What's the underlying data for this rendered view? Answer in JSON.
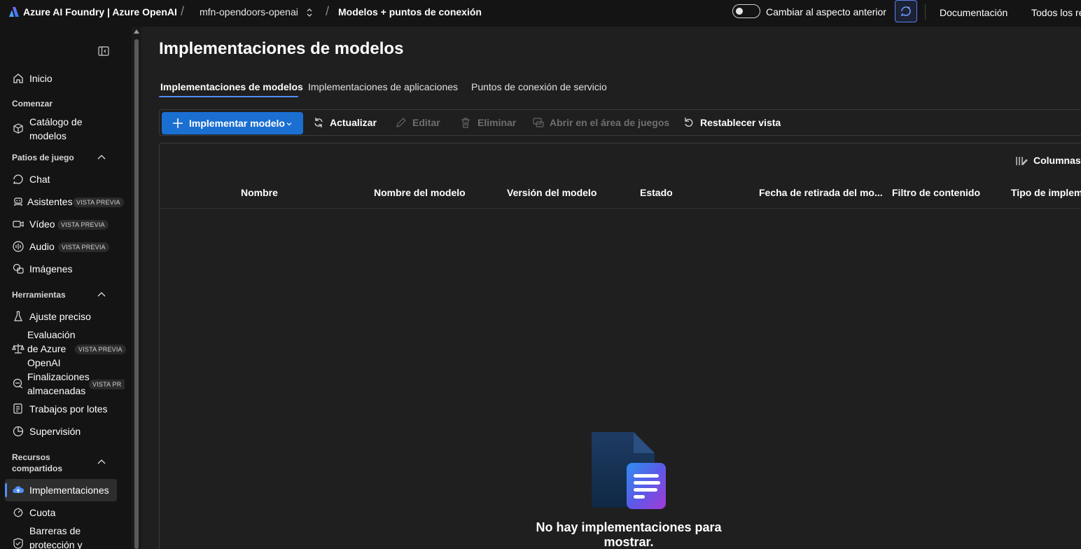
{
  "header": {
    "brand": "Azure AI Foundry | Azure OpenAI",
    "project": "mfn-opendoors-openai",
    "breadcrumb": "Modelos + puntos de conexión",
    "toggle_label": "Cambiar al aspecto anterior",
    "documentation": "Documentación",
    "all_resources": "Todos los re"
  },
  "sidebar": {
    "home": "Inicio",
    "section_start": "Comenzar",
    "catalog_line1": "Catálogo de",
    "catalog_line2": "modelos",
    "section_playgrounds": "Patios de juego",
    "chat": "Chat",
    "assistants": "Asistentes",
    "video": "Vídeo",
    "audio": "Audio",
    "images": "Imágenes",
    "preview_badge": "VISTA PREVIA",
    "preview_badge_cut": "VISTA PR",
    "section_tools": "Herramientas",
    "finetune": "Ajuste preciso",
    "eval_line1": "Evaluación",
    "eval_line2": "de Azure",
    "eval_line3": "OpenAI",
    "stored_line1": "Finalizaciones",
    "stored_line2": "almacenadas",
    "batch": "Trabajos por lotes",
    "monitoring": "Supervisión",
    "section_shared_line1": "Recursos",
    "section_shared_line2": "compartidos",
    "deployments": "Implementaciones",
    "quota": "Cuota",
    "guardrails_line1": "Barreras de",
    "guardrails_line2": "protección y"
  },
  "main": {
    "title": "Implementaciones de modelos",
    "tabs": [
      {
        "label": "Implementaciones de modelos",
        "selected": true
      },
      {
        "label": "Implementaciones de aplicaciones",
        "selected": false
      },
      {
        "label": "Puntos de conexión de servicio",
        "selected": false
      }
    ],
    "toolbar": {
      "deploy": "Implementar modelo",
      "refresh": "Actualizar",
      "edit": "Editar",
      "delete": "Eliminar",
      "open_playground": "Abrir en el área de juegos",
      "reset_view": "Restablecer vista"
    },
    "columns_button": "Columnas",
    "table_headers": [
      "Nombre",
      "Nombre del modelo",
      "Versión del modelo",
      "Estado",
      "Fecha de retirada del mo...",
      "Filtro de contenido",
      "Tipo de implem"
    ],
    "empty_message": "No hay implementaciones para mostrar."
  },
  "colors": {
    "accent": "#4f8ef7",
    "primary_button": "#1a6fd1",
    "background": "#1f1f1f",
    "sidebar": "#141414"
  }
}
